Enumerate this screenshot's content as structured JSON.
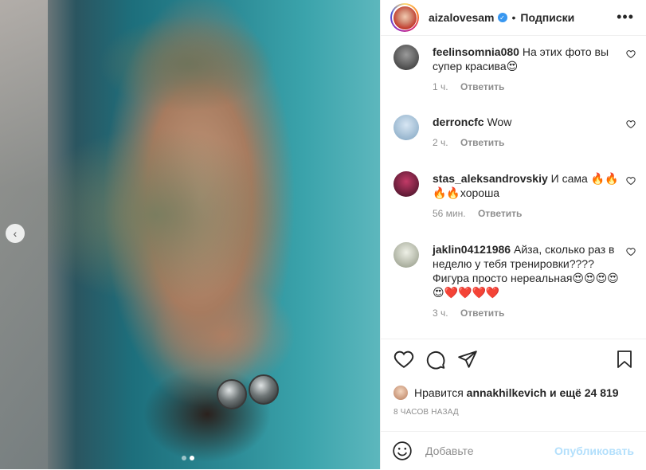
{
  "post": {
    "username": "aizalovesam",
    "separator": "•",
    "follow_label": "Подписки",
    "more_icon": "more-icon",
    "carousel": {
      "prev_icon": "chevron-left-icon",
      "slide_count": 2,
      "active_slide": 2
    }
  },
  "comments": [
    {
      "user": "feelinsomnia080",
      "text": "На этих фото вы супер красива😍",
      "time": "1 ч.",
      "reply": "Ответить"
    },
    {
      "user": "derroncfc",
      "text": "Wow",
      "time": "2 ч.",
      "reply": "Ответить"
    },
    {
      "user": "stas_aleksandrovskiy",
      "text": "И сама 🔥🔥🔥🔥хороша",
      "time": "56 мин.",
      "reply": "Ответить"
    },
    {
      "user": "jaklin04121986",
      "text": "Айза, сколько раз в неделю у тебя тренировки???? Фигура просто нереальная😍😍😍😍😍❤️❤️❤️❤️",
      "time": "3 ч.",
      "reply": "Ответить"
    }
  ],
  "likes": {
    "prefix": "Нравится",
    "user": "annakhilkevich",
    "middle": "и ещё",
    "count": "24 819"
  },
  "time_ago": "8 ЧАСОВ НАЗАД",
  "add_comment": {
    "placeholder": "Добавьте",
    "publish_label": "Опубликовать"
  },
  "colors": {
    "accent_blue": "#3897f0",
    "publish_disabled": "#b2dffc",
    "muted_text": "#8e8e8e"
  }
}
